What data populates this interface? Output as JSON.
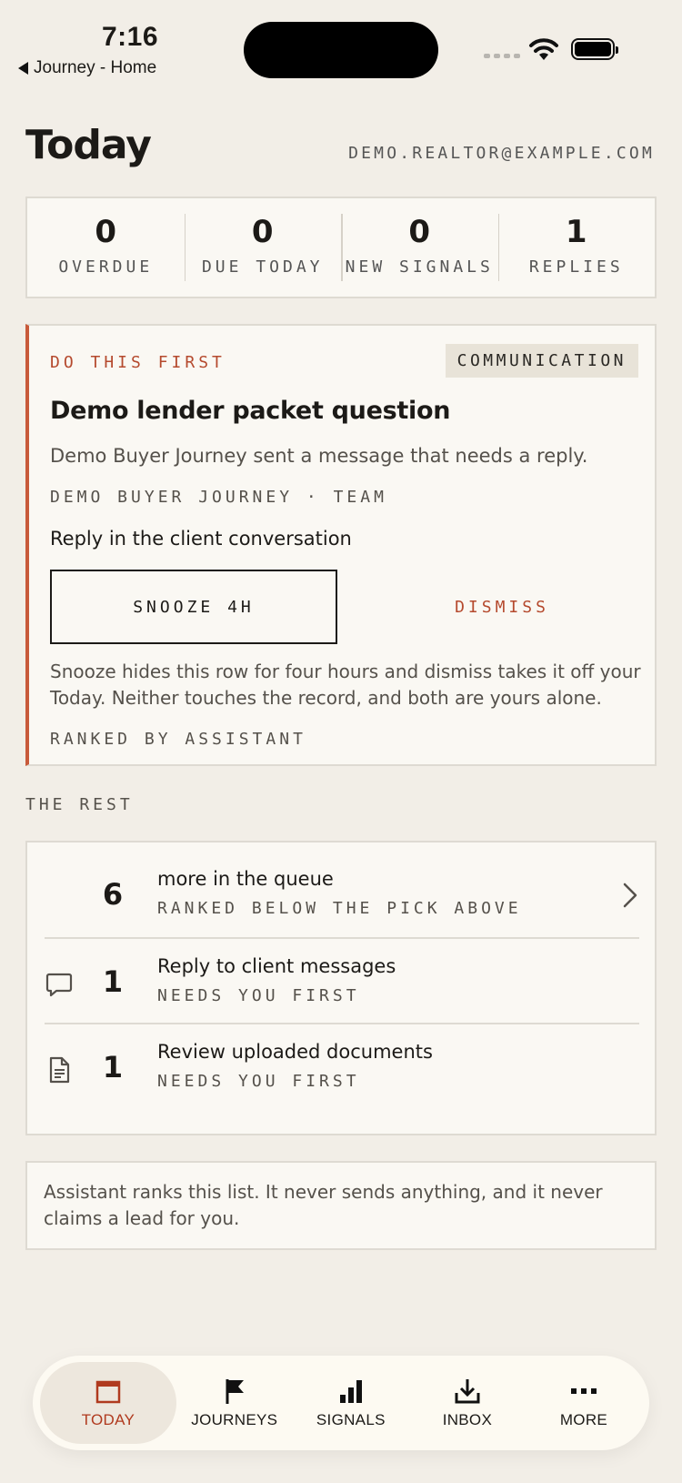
{
  "status_bar": {
    "time": "7:16",
    "back_label": "Journey - Home"
  },
  "header": {
    "title": "Today",
    "user_email": "DEMO.REALTOR@EXAMPLE.COM"
  },
  "stats": [
    {
      "value": "0",
      "label": "OVERDUE"
    },
    {
      "value": "0",
      "label": "DUE TODAY"
    },
    {
      "value": "0",
      "label": "NEW SIGNALS"
    },
    {
      "value": "1",
      "label": "REPLIES"
    }
  ],
  "first_card": {
    "kicker": "DO THIS FIRST",
    "badge": "COMMUNICATION",
    "title": "Demo lender packet question",
    "description": "Demo Buyer Journey sent a message that needs a reply.",
    "meta": "DEMO BUYER JOURNEY · TEAM",
    "action": "Reply in the client conversation",
    "snooze_label": "SNOOZE 4H",
    "dismiss_label": "DISMISS",
    "note": "Snooze hides this row for four hours and dismiss takes it off your Today. Neither touches the record, and both are yours alone.",
    "ranked_by": "RANKED BY ASSISTANT"
  },
  "rest": {
    "heading": "THE REST",
    "rows": [
      {
        "icon": "none",
        "count": "6",
        "title": "more in the queue",
        "subtitle": "RANKED BELOW THE PICK ABOVE"
      },
      {
        "icon": "chat-bubble-icon",
        "count": "1",
        "title": "Reply to client messages",
        "subtitle": "NEEDS YOU FIRST"
      },
      {
        "icon": "document-icon",
        "count": "1",
        "title": "Review uploaded documents",
        "subtitle": "NEEDS YOU FIRST"
      }
    ]
  },
  "footnote": "Assistant ranks this list. It never sends anything, and it never claims a lead for you.",
  "tabbar": {
    "active": "today",
    "tabs": [
      {
        "label": "TODAY",
        "icon": "calendar-icon"
      },
      {
        "label": "JOURNEYS",
        "icon": "flag-icon"
      },
      {
        "label": "SIGNALS",
        "icon": "bar-chart-icon"
      },
      {
        "label": "INBOX",
        "icon": "inbox-download-icon"
      },
      {
        "label": "MORE",
        "icon": "more-dots-icon"
      }
    ]
  },
  "colors": {
    "background": "#f2eee7",
    "card": "#faf8f3",
    "accent": "#b54a2e",
    "border": "#dedad2"
  }
}
